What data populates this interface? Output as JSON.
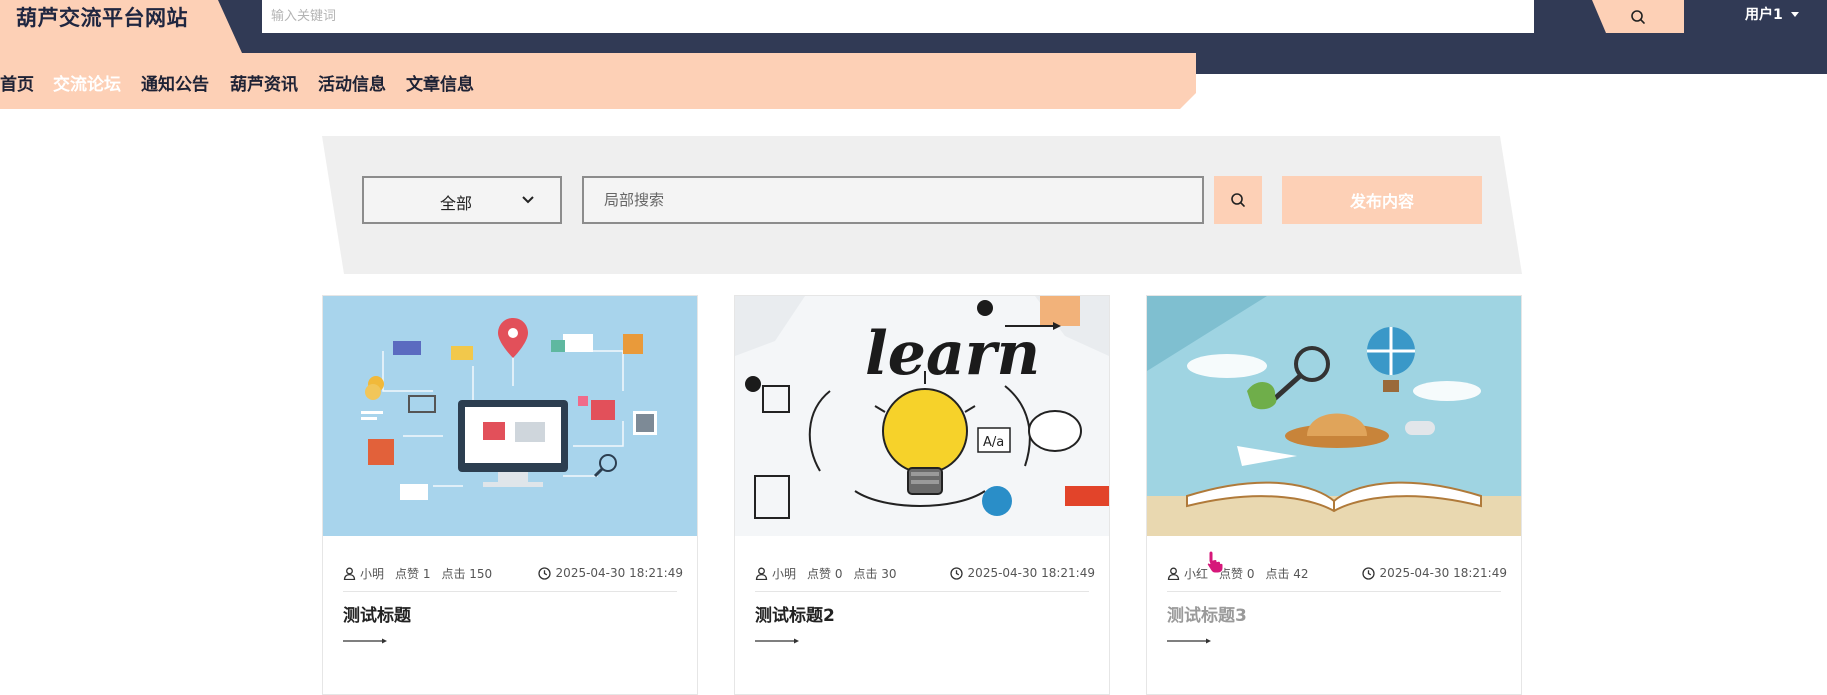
{
  "header": {
    "site_title": "葫芦交流平台网站",
    "search_placeholder": "输入关键词",
    "search_icon": "search-icon",
    "user_label": "用户1",
    "colors": {
      "bar": "#313a55",
      "accent": "#fdd0b6"
    }
  },
  "nav": {
    "items": [
      {
        "label": "首页",
        "active": false
      },
      {
        "label": "交流论坛",
        "active": true
      },
      {
        "label": "通知公告",
        "active": false
      },
      {
        "label": "葫芦资讯",
        "active": false
      },
      {
        "label": "活动信息",
        "active": false
      },
      {
        "label": "文章信息",
        "active": false
      }
    ]
  },
  "filter": {
    "category_selected": "全部",
    "search_placeholder": "局部搜索",
    "search_icon": "search-icon",
    "publish_label": "发布内容"
  },
  "cards": [
    {
      "author": "小明",
      "likes": "点赞 1",
      "clicks": "点击 150",
      "time": "2025-04-30 18:21:49",
      "title": "测试标题",
      "image": "ecommerce-computer-illustration"
    },
    {
      "author": "小明",
      "likes": "点赞 0",
      "clicks": "点击 30",
      "time": "2025-04-30 18:21:49",
      "title": "测试标题2",
      "image": "learn-lightbulb-illustration"
    },
    {
      "author": "小红",
      "likes": "点赞 0",
      "clicks": "点击 42",
      "time": "2025-04-30 18:21:49",
      "title": "测试标题3",
      "image": "open-book-travel-illustration"
    }
  ]
}
